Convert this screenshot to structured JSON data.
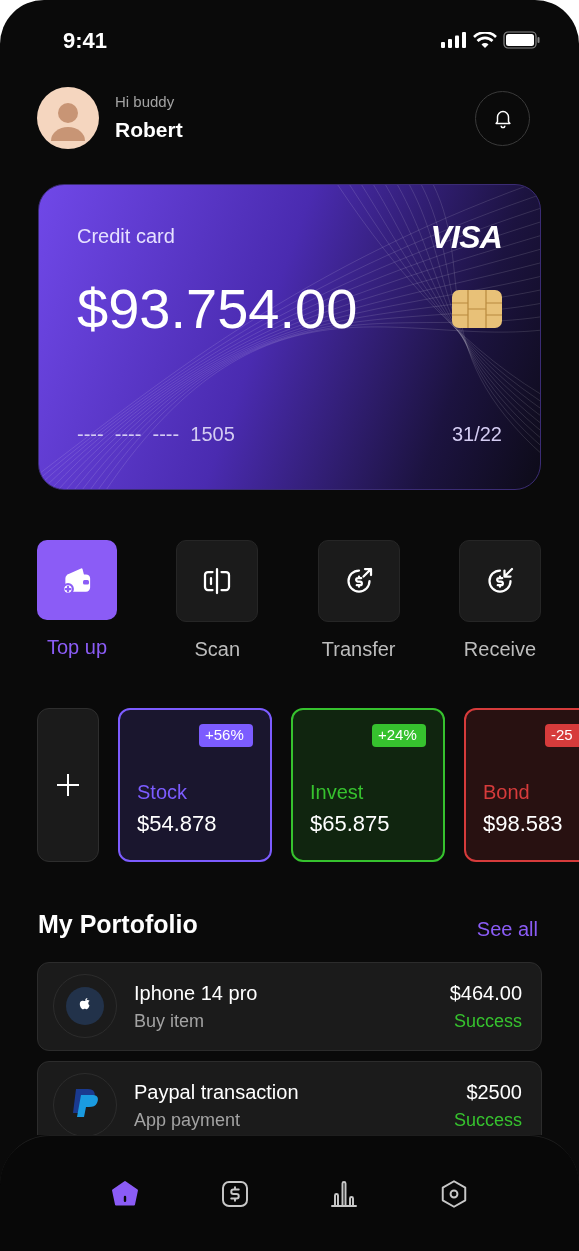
{
  "status_bar": {
    "time": "9:41"
  },
  "header": {
    "greeting": "Hi buddy",
    "name": "Robert"
  },
  "card": {
    "label": "Credit card",
    "brand": "VISA",
    "balance": "$93.754.00",
    "number": "----  ----  ----  1505",
    "expiry": "31/22"
  },
  "actions": [
    {
      "kind": "topup",
      "label": "Top up",
      "selected": true
    },
    {
      "kind": "scan",
      "label": "Scan",
      "selected": false
    },
    {
      "kind": "transfer",
      "label": "Transfer",
      "selected": false
    },
    {
      "kind": "receive",
      "label": "Receive",
      "selected": false
    }
  ],
  "assets": [
    {
      "name": "Stock",
      "value": "$54.878",
      "change": "+56%",
      "color": "#7c5cff"
    },
    {
      "name": "Invest",
      "value": "$65.875",
      "change": "+24%",
      "color": "#36c22e"
    },
    {
      "name": "Bond",
      "value": "$98.583",
      "change": "-25",
      "color": "#d63b3b"
    }
  ],
  "portfolio": {
    "title": "My Portofolio",
    "see_all": "See all",
    "items": [
      {
        "kind": "apple",
        "title": "Iphone 14 pro",
        "subtitle": "Buy item",
        "amount": "$464.00",
        "status": "Success"
      },
      {
        "kind": "paypal",
        "title": "Paypal transaction",
        "subtitle": "App payment",
        "amount": "$2500",
        "status": "Success"
      }
    ]
  },
  "nav": [
    {
      "kind": "home",
      "selected": true
    },
    {
      "kind": "wallet",
      "selected": false
    },
    {
      "kind": "stats",
      "selected": false
    },
    {
      "kind": "settings",
      "selected": false
    }
  ]
}
